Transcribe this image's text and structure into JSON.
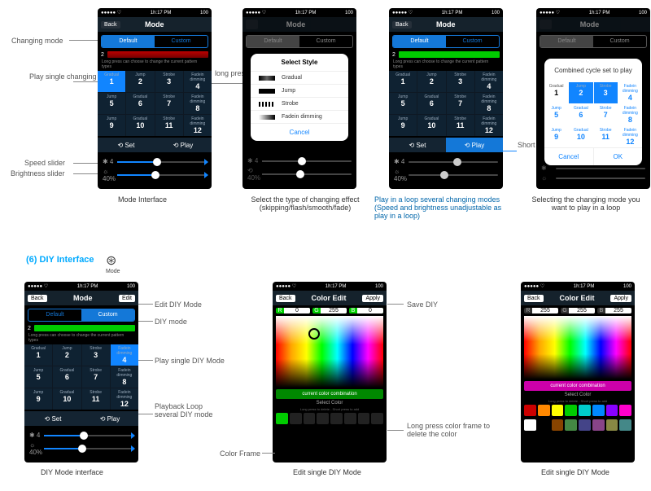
{
  "status": {
    "carrier": "●●●●● ♡",
    "time": "1h:17 PM",
    "batt": "100"
  },
  "section6": "(6)  DIY Interface",
  "phone": {
    "back": "Back",
    "mode": "Mode",
    "edit": "Edit",
    "seg_default": "Default",
    "seg_custom": "Custom",
    "hint": "Long press can choose to change the current pattern types",
    "set": "⟲ Set",
    "play": "⟲ Play",
    "speed": "✱ 4",
    "bright": "☼ 40%",
    "bright2": "⟲ 40%"
  },
  "grid12": [
    {
      "t": "Gradual",
      "v": "1"
    },
    {
      "t": "Jump",
      "v": "2"
    },
    {
      "t": "Strobe",
      "v": "3"
    },
    {
      "t": "Fadein dimming",
      "v": "4"
    },
    {
      "t": "Jump",
      "v": "5"
    },
    {
      "t": "Gradual",
      "v": "6"
    },
    {
      "t": "Strobe",
      "v": "7"
    },
    {
      "t": "Fadein dimming",
      "v": "8"
    },
    {
      "t": "Jump",
      "v": "9"
    },
    {
      "t": "Gradual",
      "v": "10"
    },
    {
      "t": "Strobe",
      "v": "11"
    },
    {
      "t": "Fadein dimming",
      "v": "12"
    }
  ],
  "styleModal": {
    "title": "Select Style",
    "opts": [
      "Gradual",
      "Jump",
      "Strobe",
      "Fadein dimming"
    ],
    "cancel": "Cancel"
  },
  "playModal": {
    "body": "Combined cycle set to play",
    "cancel": "Cancel",
    "ok": "OK"
  },
  "captions": {
    "c1": "Mode Interface",
    "c2": "Select the type of changing effect (skipping/flash/smooth/fade)",
    "c3": "Play in a loop several changing modes (Speed and brightness unadjustable as play in a loop)",
    "c4": "Selecting the changing mode you want to play in a loop",
    "c5": "DIY Mode interface",
    "c6": "Edit single DIY Mode",
    "c7": "Edit single DIY Mode"
  },
  "annot": {
    "changing_mode": "Changing mode",
    "play_single": "Play single changing mode",
    "long_press": "long press",
    "short_press": "Short press",
    "speed_slider": "Speed slider",
    "bright_slider": "Brightness slider",
    "edit_diy": "Edit DIY Mode",
    "diy_mode": "DIY mode",
    "play_single_diy": "Play single DIY Mode",
    "playback_loop": "Playback Loop several DIY mode",
    "save_diy": "Save DIY",
    "long_press_color": "Long press color frame to delete the color",
    "color_frame": "Color Frame"
  },
  "colorEdit": {
    "title": "Color Edit",
    "apply": "Apply",
    "r": "R",
    "g": "G",
    "b": "B",
    "v1": {
      "r": "0",
      "g": "255",
      "b": "0"
    },
    "v2": {
      "r": "255",
      "g": "255",
      "b": "255"
    },
    "ccc": "current color combination",
    "sc": "Select Color",
    "sc_hint": "Long press to delete - Short press to add"
  },
  "swatches1": [
    "#0c0",
    "#222",
    "#222",
    "#222",
    "#222",
    "#222",
    "#222",
    "#222"
  ],
  "swatches2a": [
    "#c00",
    "#f80",
    "#ff0",
    "#0c0",
    "#0cc",
    "#08f",
    "#80f",
    "#f0c"
  ],
  "swatches2b": [
    "#fff",
    "#000",
    "#840",
    "#484",
    "#448",
    "#848",
    "#884",
    "#488"
  ]
}
